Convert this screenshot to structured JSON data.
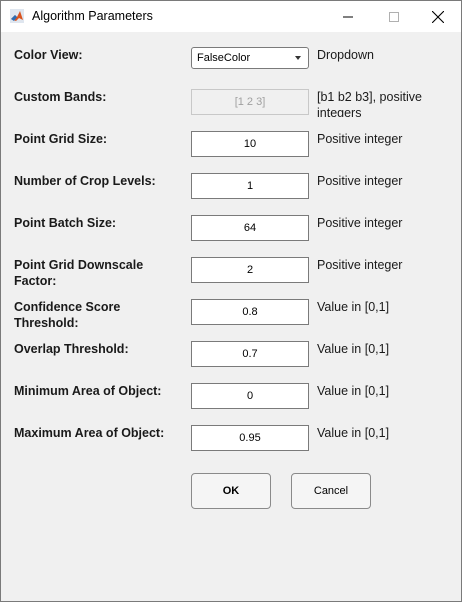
{
  "window": {
    "title": "Algorithm Parameters"
  },
  "params": {
    "color_view": {
      "label": "Color View:",
      "value": "FalseColor",
      "hint": "Dropdown"
    },
    "custom_bands": {
      "label": "Custom Bands:",
      "value": "[1 2 3]",
      "hint_line1": "[b1 b2 b3], positive",
      "hint_line2": "integers"
    },
    "point_grid_size": {
      "label": "Point Grid Size:",
      "value": "10",
      "hint": "Positive integer"
    },
    "crop_levels": {
      "label": "Number of Crop Levels:",
      "value": "1",
      "hint": "Positive integer"
    },
    "point_batch_size": {
      "label": "Point Batch Size:",
      "value": "64",
      "hint": "Positive integer"
    },
    "downscale": {
      "label_line1": "Point Grid Downscale",
      "label_line2": "Factor:",
      "value": "2",
      "hint": "Positive integer"
    },
    "confidence": {
      "label_line1": "Confidence Score",
      "label_line2": "Threshold:",
      "value": "0.8",
      "hint": "Value in [0,1]"
    },
    "overlap": {
      "label": "Overlap Threshold:",
      "value": "0.7",
      "hint": "Value in [0,1]"
    },
    "min_area": {
      "label": "Minimum Area of Object:",
      "value": "0",
      "hint": "Value in [0,1]"
    },
    "max_area": {
      "label": "Maximum Area of Object:",
      "value": "0.95",
      "hint": "Value in [0,1]"
    }
  },
  "buttons": {
    "ok": "OK",
    "cancel": "Cancel"
  },
  "icons": {
    "app": "matlab-icon",
    "minimize": "minimize-icon",
    "maximize": "maximize-icon",
    "close": "close-icon"
  }
}
